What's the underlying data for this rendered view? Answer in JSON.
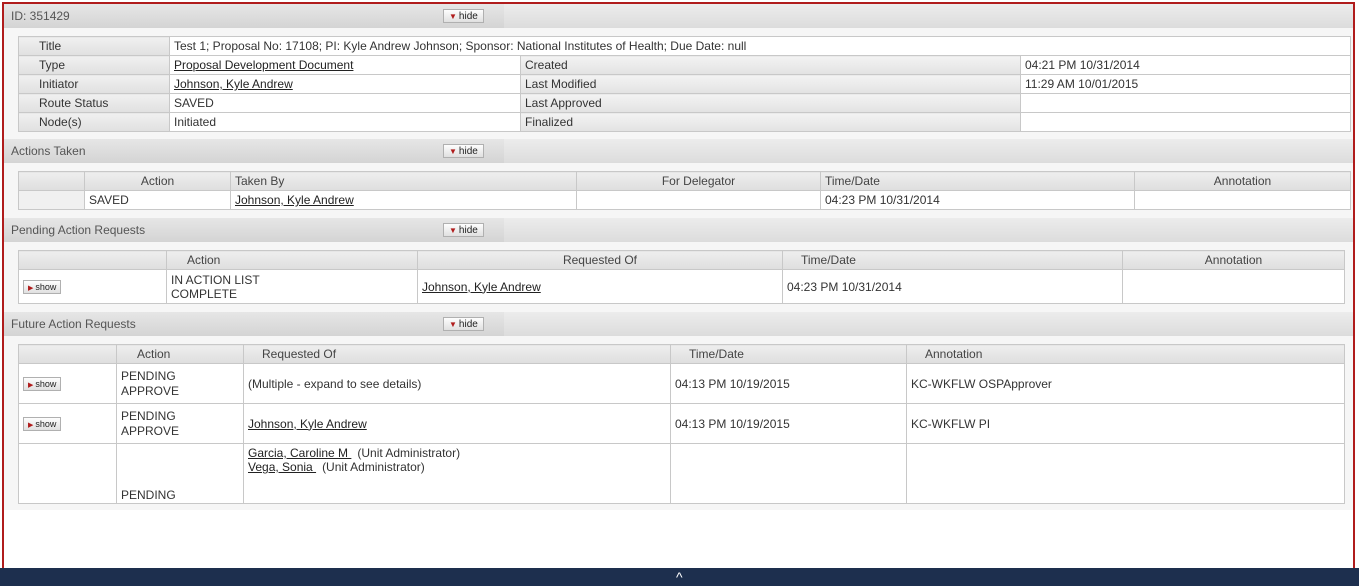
{
  "doc": {
    "id_label": "ID: 351429",
    "hide_label": "hide",
    "rows": {
      "title": {
        "label": "Title",
        "value": "Test 1; Proposal No: 17108; PI: Kyle Andrew Johnson; Sponsor: National Institutes of Health; Due Date: null"
      },
      "type": {
        "label": "Type",
        "value": "Proposal Development Document",
        "label2": "Created",
        "value2": "04:21 PM 10/31/2014"
      },
      "initiator": {
        "label": "Initiator",
        "value": "Johnson, Kyle Andrew ",
        "label2": "Last Modified",
        "value2": "11:29 AM 10/01/2015"
      },
      "route": {
        "label": "Route Status",
        "value": "SAVED",
        "label2": "Last Approved",
        "value2": ""
      },
      "nodes": {
        "label": "Node(s)",
        "value": "Initiated",
        "label2": "Finalized",
        "value2": ""
      }
    }
  },
  "actions_taken": {
    "title": "Actions Taken",
    "hide_label": "hide",
    "headers": [
      "Action",
      "Taken By",
      "For Delegator",
      "Time/Date",
      "Annotation"
    ],
    "rows": [
      {
        "action": "SAVED",
        "taken_by": "Johnson, Kyle Andrew ",
        "for_delegator": "",
        "time": "04:23 PM 10/31/2014",
        "annotation": ""
      }
    ]
  },
  "pending": {
    "title": "Pending Action Requests",
    "hide_label": "hide",
    "headers": [
      "Action",
      "Requested Of",
      "Time/Date",
      "Annotation"
    ],
    "show_label": "show",
    "rows": [
      {
        "action_line1": "IN ACTION LIST",
        "action_line2": "COMPLETE",
        "requested_of": "Johnson, Kyle Andrew ",
        "time": "04:23 PM 10/31/2014",
        "annotation": ""
      }
    ]
  },
  "future": {
    "title": "Future Action Requests",
    "hide_label": "hide",
    "headers": [
      "Action",
      "Requested Of",
      "Time/Date",
      "Annotation"
    ],
    "show_label": "show",
    "rows": [
      {
        "action_line1": "PENDING",
        "action_line2": "APPROVE",
        "requested_of": "(Multiple - expand to see details)",
        "time": "04:13 PM 10/19/2015",
        "annotation": "KC-WKFLW OSPApprover"
      },
      {
        "action_line1": "PENDING",
        "action_line2": "APPROVE",
        "requested_of": "Johnson, Kyle Andrew ",
        "time": "04:13 PM 10/19/2015",
        "annotation": "KC-WKFLW PI"
      },
      {
        "action_line1": "PENDING",
        "action_line2": "",
        "requested_of_1": "Garcia, Caroline M ",
        "role_1": "(Unit Administrator)",
        "requested_of_2": "Vega, Sonia ",
        "role_2": "(Unit Administrator)",
        "time": "",
        "annotation": ""
      }
    ]
  },
  "footer": {
    "caret": "^"
  }
}
